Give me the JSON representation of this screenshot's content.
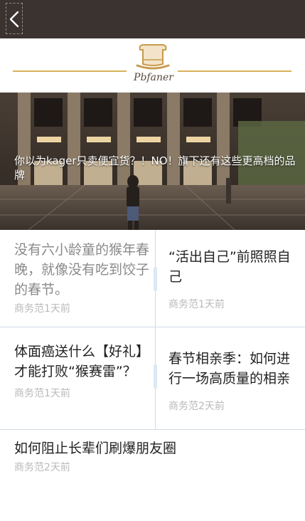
{
  "header": {
    "back_label": "back"
  },
  "logo": {
    "text": "Pbfaner"
  },
  "hero": {
    "caption": "你以为kager只卖便宜货？！NO！旗下还有这些更高档的品牌"
  },
  "articles": [
    {
      "title": "没有六小龄童的猴年春晚，就像没有吃到饺子的春节。",
      "meta": "商务范1天前"
    },
    {
      "title": "“活出自己”前照照自己",
      "meta": "商务范1天前"
    },
    {
      "title": "体面癌送什么【好礼】才能打败“猴赛雷”？",
      "meta": "商务范1天前"
    },
    {
      "title": "春节相亲季：如何进行一场高质量的相亲",
      "meta": "商务范2天前"
    },
    {
      "title": "如何阻止长辈们刷爆朋友圈",
      "meta": "商务范2天前"
    }
  ],
  "colors": {
    "topbar": "#3a3330",
    "gold": "#d8b15a",
    "divider": "#cfdbe6"
  }
}
